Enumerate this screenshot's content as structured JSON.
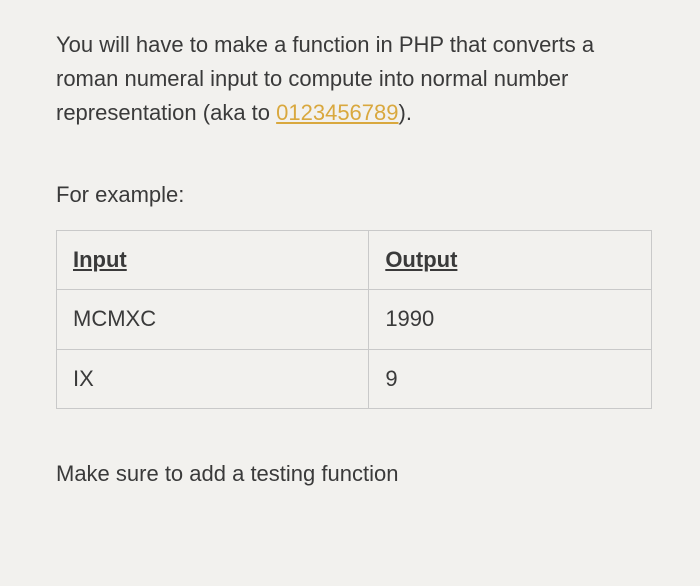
{
  "intro": {
    "part1": "You will have to make a function in PHP that converts a  roman numeral input to compute into normal number representation (aka to ",
    "link_text": "0123456789",
    "part2": ")."
  },
  "example_label": "For example:",
  "table": {
    "headers": {
      "input": "Input",
      "output": "Output"
    },
    "rows": [
      {
        "input": "MCMXC",
        "output": "1990"
      },
      {
        "input": "IX",
        "output": "9"
      }
    ]
  },
  "footer": "Make sure to add a testing function"
}
